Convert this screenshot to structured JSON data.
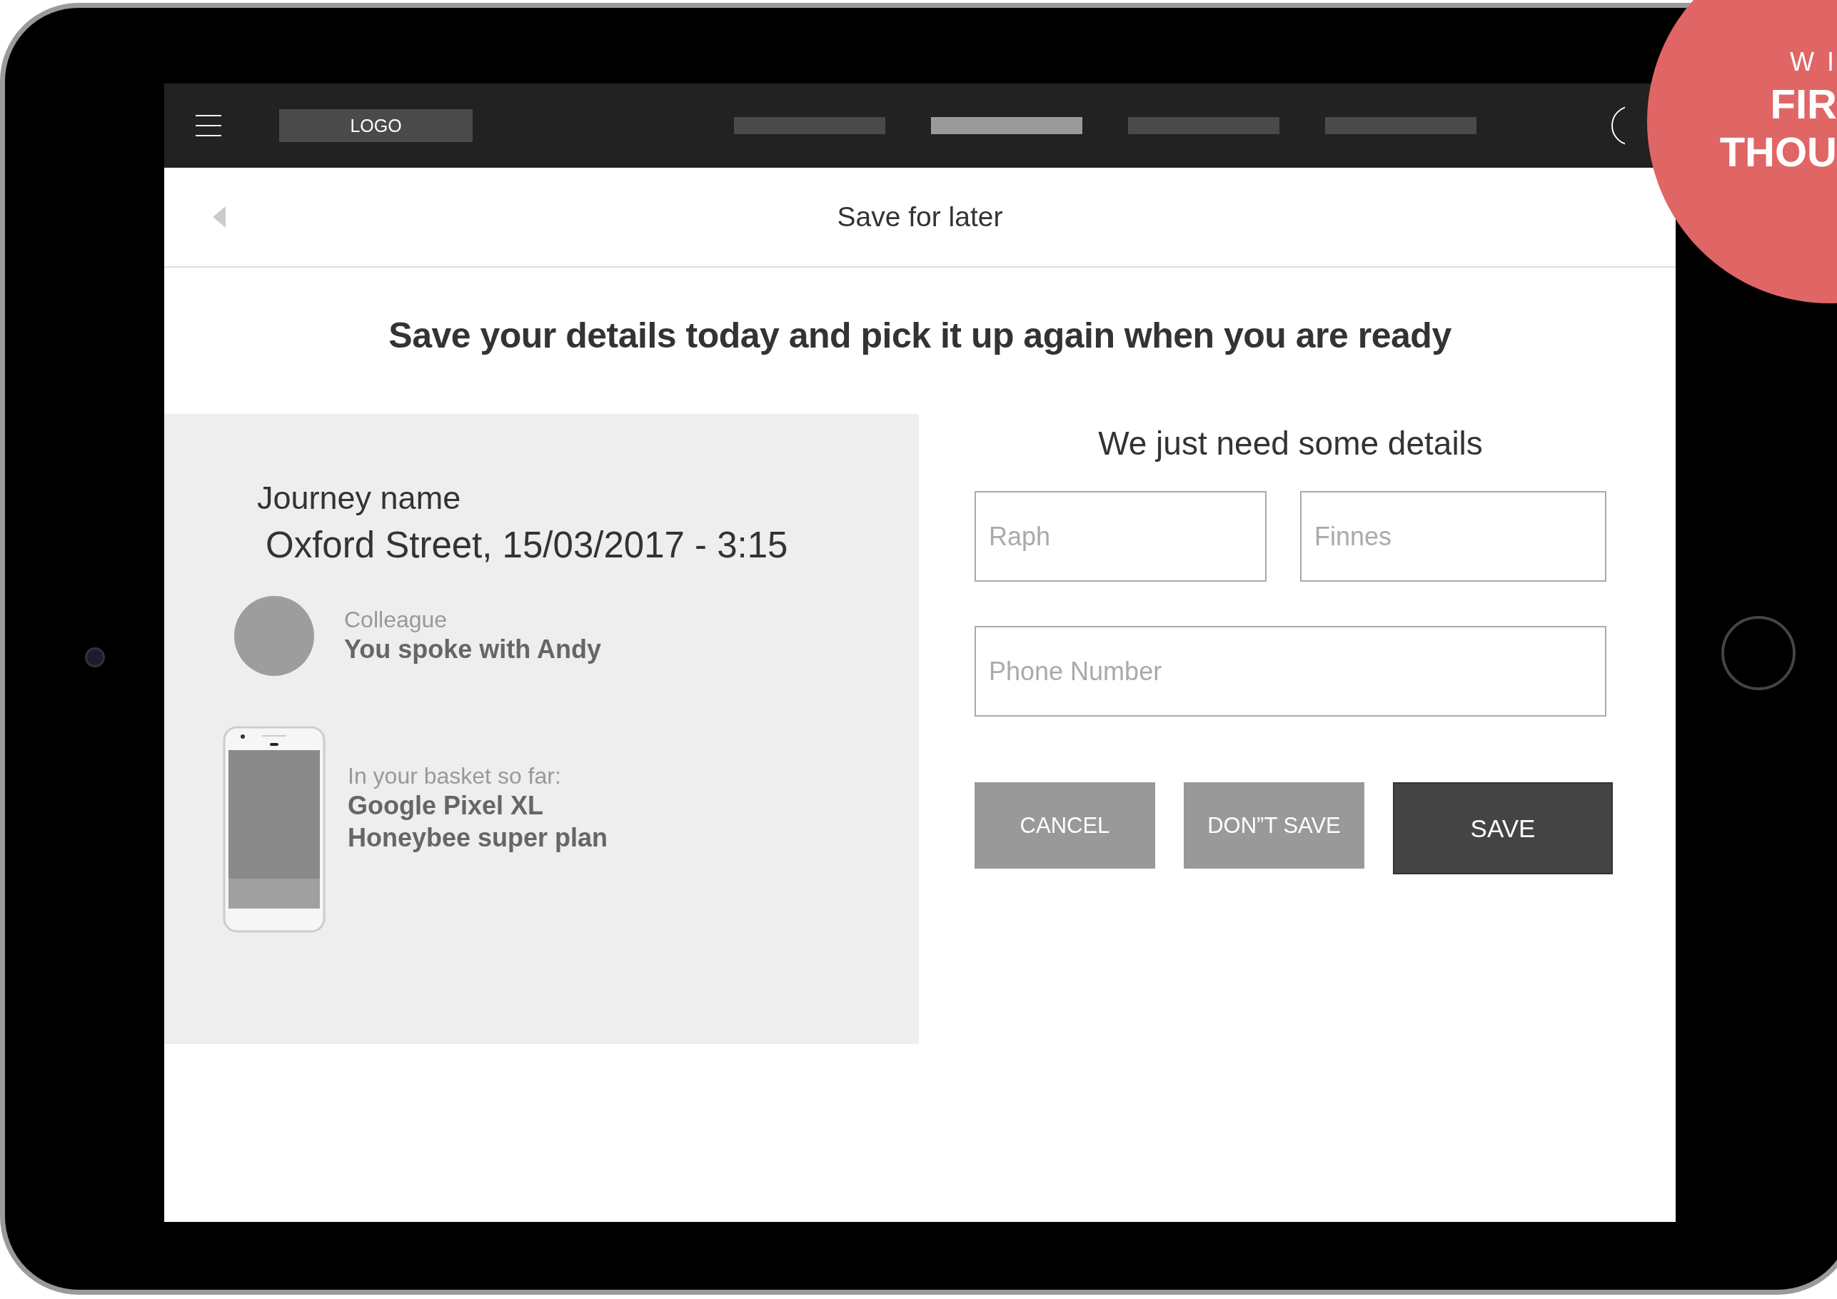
{
  "nav": {
    "logo": "LOGO",
    "tabs": [
      {
        "selected": false
      },
      {
        "selected": true
      },
      {
        "selected": false
      },
      {
        "selected": false
      }
    ]
  },
  "header": {
    "title": "Save for later"
  },
  "headline": "Save your details today and pick it up again when you are ready",
  "summary": {
    "journey_label": "Journey name",
    "journey_value": "Oxford Street, 15/03/2017 - 3:15",
    "colleague_label": "Colleague",
    "colleague_text": "You spoke with Andy",
    "basket_label": "In your basket so far:",
    "basket_items": [
      "Google Pixel XL",
      "Honeybee super plan"
    ]
  },
  "form": {
    "title": "We just need some details",
    "fields": [
      {
        "placeholder": "Raph"
      },
      {
        "placeholder": "Finnes"
      },
      {
        "placeholder": "Phone Number"
      }
    ],
    "buttons": [
      {
        "label": "CANCEL",
        "kind": "secondary"
      },
      {
        "label": "DON”T SAVE",
        "kind": "secondary"
      },
      {
        "label": "SAVE",
        "kind": "primary"
      }
    ]
  },
  "badge": {
    "lines": [
      "W I",
      "FIR",
      "THOU"
    ]
  }
}
